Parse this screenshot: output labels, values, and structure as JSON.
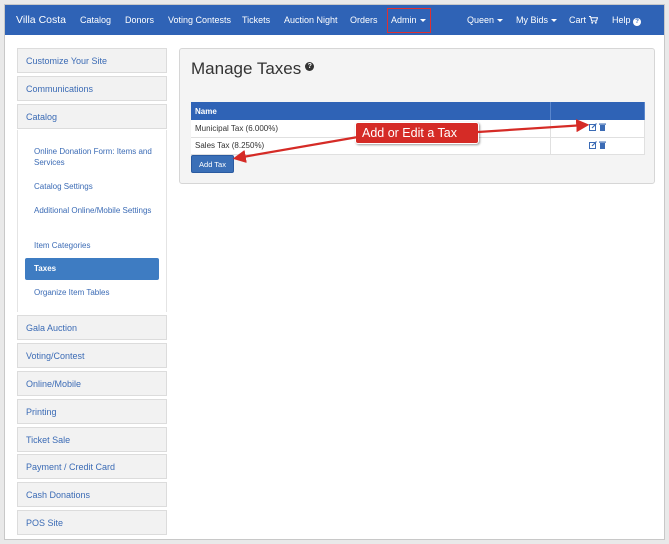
{
  "navbar": {
    "brand": "Villa Costa",
    "items": [
      "Catalog",
      "Donors",
      "Voting Contests",
      "Tickets",
      "Auction Night",
      "Orders"
    ],
    "admin": "Admin",
    "right": {
      "queen": "Queen",
      "my_bids": "My Bids",
      "cart": "Cart",
      "help": "Help"
    }
  },
  "sidebar": {
    "top_items": [
      "Customize Your Site",
      "Communications",
      "Catalog"
    ],
    "catalog_sub": {
      "item1": "Online Donation Form: Items and Services",
      "item2": "Catalog Settings",
      "item3": "Additional Online/Mobile Settings",
      "item4": "Item Categories",
      "active": "Taxes",
      "item6": "Organize Item Tables"
    },
    "bottom_items": [
      "Gala Auction",
      "Voting/Contest",
      "Online/Mobile",
      "Printing",
      "Ticket Sale",
      "Payment / Credit Card",
      "Cash Donations",
      "POS Site"
    ]
  },
  "main": {
    "title": "Manage Taxes",
    "help_icon": "?",
    "table": {
      "header": "Name",
      "rows": [
        "Municipal Tax (6.000%)",
        "Sales Tax (8.250%)"
      ]
    },
    "add_button": "Add Tax"
  },
  "callout": {
    "text": "Add or Edit a Tax",
    "color": "#d52b26"
  },
  "colors": {
    "navbar": "#2f63b6",
    "link": "#3b6bb5",
    "active": "#3e7cc2",
    "highlight_border": "#e03030"
  }
}
